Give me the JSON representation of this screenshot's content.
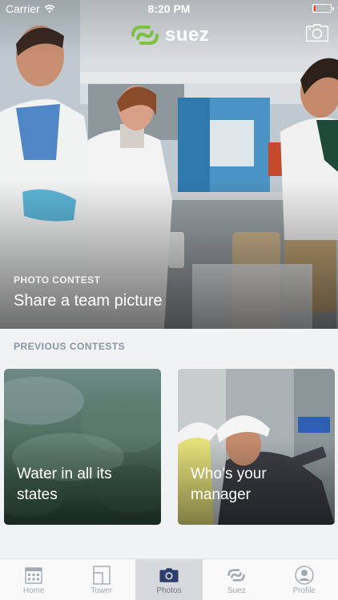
{
  "status_bar": {
    "carrier": "Carrier",
    "time": "8:20 PM",
    "battery_level": 0.1,
    "battery_color": "#ff3b30"
  },
  "header": {
    "brand_name": "suez",
    "brand_color": "#7cc242",
    "camera_icon": "camera-icon"
  },
  "hero": {
    "eyebrow": "PHOTO CONTEST",
    "title": "Share a team picture"
  },
  "previous_contests": {
    "title": "PREVIOUS CONTESTS",
    "cards": [
      {
        "title_line1": "Water in all its",
        "title_line2": "states"
      },
      {
        "title_line1": "Who’s your",
        "title_line2": "manager"
      }
    ]
  },
  "tabbar": {
    "items": [
      {
        "label": "Home",
        "icon": "home-icon",
        "active": false
      },
      {
        "label": "Tower",
        "icon": "tower-icon",
        "active": false
      },
      {
        "label": "Photos",
        "icon": "camera-icon",
        "active": true
      },
      {
        "label": "Suez",
        "icon": "suez-logo-icon",
        "active": false
      },
      {
        "label": "Profile",
        "icon": "profile-icon",
        "active": false
      }
    ]
  }
}
